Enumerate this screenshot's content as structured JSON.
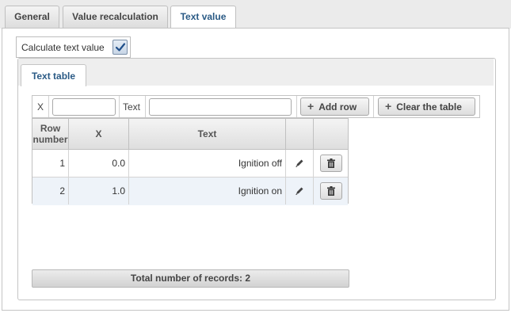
{
  "tabs": [
    {
      "label": "General",
      "active": false
    },
    {
      "label": "Value recalculation",
      "active": false
    },
    {
      "label": "Text value",
      "active": true
    }
  ],
  "calc_checkbox": {
    "label": "Calculate text value",
    "checked": true
  },
  "inner_tab": {
    "label": "Text table"
  },
  "toolbar": {
    "x_label": "X",
    "x_value": "",
    "text_label": "Text",
    "text_value": "",
    "add_row_label": "Add row",
    "clear_label": "Clear the table"
  },
  "table": {
    "columns": [
      "Row number",
      "X",
      "Text",
      "",
      ""
    ],
    "rows": [
      {
        "row_number": "1",
        "x": "0.0",
        "text": "Ignition off"
      },
      {
        "row_number": "2",
        "x": "1.0",
        "text": "Ignition on"
      }
    ]
  },
  "footer": {
    "total_label": "Total number of records: 2"
  },
  "icons": {
    "edit": "pencil-icon",
    "delete": "trash-icon",
    "add": "plus-icon",
    "check": "checkmark-icon"
  },
  "colors": {
    "active_tab_text": "#2a5a85",
    "alt_row": "#eef3f9"
  }
}
